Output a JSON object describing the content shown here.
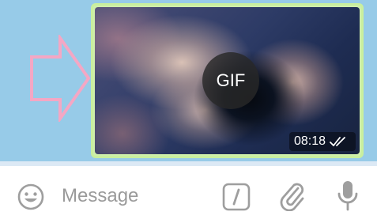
{
  "message": {
    "type_badge": "GIF",
    "time": "08:18",
    "status": "read-double-check"
  },
  "composer": {
    "placeholder": "Message"
  },
  "icons": {
    "emoji": "emoji-icon",
    "commands": "bot-command-icon",
    "attach": "paperclip-icon",
    "mic": "microphone-icon",
    "arrow": "right-arrow-outline"
  },
  "colors": {
    "chat_background": "#97cbe8",
    "bubble_border": "#c9ef9e",
    "arrow_stroke": "#f4a7c4",
    "icon_gray": "#9e9e9e"
  }
}
